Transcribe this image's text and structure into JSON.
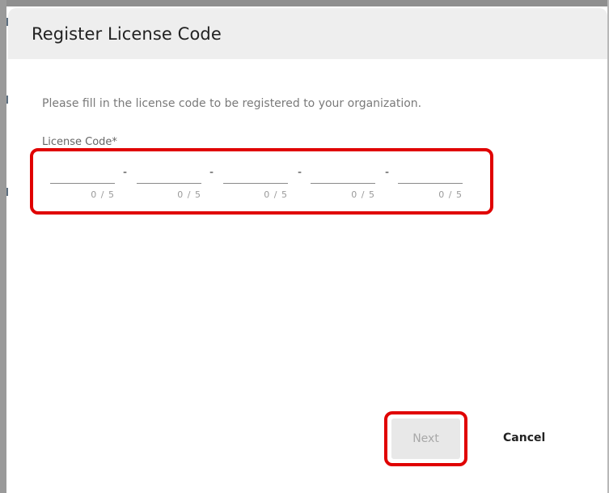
{
  "dialog": {
    "title": "Register License Code",
    "instruction": "Please fill in the license code to be registered to your organization.",
    "field_label": "License Code*",
    "separator": "-",
    "segments": [
      {
        "value": "",
        "counter": "0 / 5"
      },
      {
        "value": "",
        "counter": "0 / 5"
      },
      {
        "value": "",
        "counter": "0 / 5"
      },
      {
        "value": "",
        "counter": "0 / 5"
      },
      {
        "value": "",
        "counter": "0 / 5"
      }
    ],
    "buttons": {
      "next": "Next",
      "cancel": "Cancel"
    }
  },
  "colors": {
    "highlight": "#e00000",
    "header_bg": "#eeeeee",
    "next_disabled_bg": "#e8e8e8"
  }
}
